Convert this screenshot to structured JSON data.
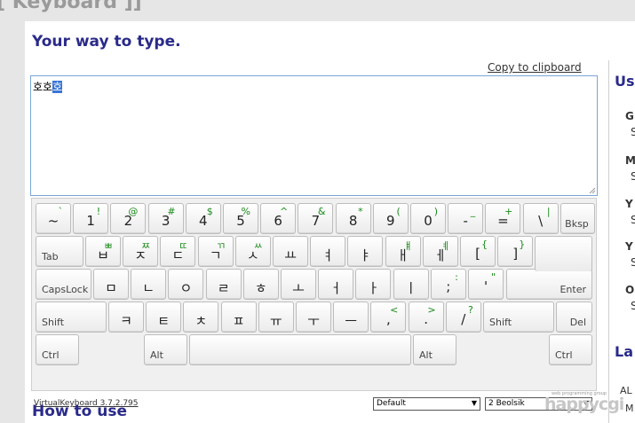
{
  "topbar": {
    "title": "[ Keyboard ]]"
  },
  "main": {
    "heading": "Your way to type.",
    "heading2": "How to use",
    "copy_label": "Copy to clipboard",
    "text_plain": "호호",
    "text_selected": "호"
  },
  "keyboard": {
    "version_link": "VirtualKeyboard 3.7.2.795",
    "skin_select": "Default",
    "layout_select": "2 Beolsik",
    "row1": [
      {
        "m": "~",
        "s": "`"
      },
      {
        "m": "1",
        "s": "!"
      },
      {
        "m": "2",
        "s": "@"
      },
      {
        "m": "3",
        "s": "#"
      },
      {
        "m": "4",
        "s": "$"
      },
      {
        "m": "5",
        "s": "%"
      },
      {
        "m": "6",
        "s": "^"
      },
      {
        "m": "7",
        "s": "&"
      },
      {
        "m": "8",
        "s": "*"
      },
      {
        "m": "9",
        "s": "("
      },
      {
        "m": "0",
        "s": ")"
      },
      {
        "m": "-",
        "s": "_"
      },
      {
        "m": "=",
        "s": "+"
      },
      {
        "m": "\\",
        "s": "|"
      }
    ],
    "row2": [
      {
        "m": "ㅂ",
        "s": "ㅃ"
      },
      {
        "m": "ㅈ",
        "s": "ㅉ"
      },
      {
        "m": "ㄷ",
        "s": "ㄸ"
      },
      {
        "m": "ㄱ",
        "s": "ㄲ"
      },
      {
        "m": "ㅅ",
        "s": "ㅆ"
      },
      {
        "m": "ㅛ",
        "s": ""
      },
      {
        "m": "ㅕ",
        "s": ""
      },
      {
        "m": "ㅑ",
        "s": ""
      },
      {
        "m": "ㅐ",
        "s": "ㅒ"
      },
      {
        "m": "ㅔ",
        "s": "ㅖ"
      },
      {
        "m": "[",
        "s": "{"
      },
      {
        "m": "]",
        "s": "}"
      }
    ],
    "row3": [
      {
        "m": "ㅁ",
        "s": ""
      },
      {
        "m": "ㄴ",
        "s": ""
      },
      {
        "m": "ㅇ",
        "s": ""
      },
      {
        "m": "ㄹ",
        "s": ""
      },
      {
        "m": "ㅎ",
        "s": ""
      },
      {
        "m": "ㅗ",
        "s": ""
      },
      {
        "m": "ㅓ",
        "s": ""
      },
      {
        "m": "ㅏ",
        "s": ""
      },
      {
        "m": "ㅣ",
        "s": ""
      },
      {
        "m": ";",
        "s": ":"
      },
      {
        "m": "'",
        "s": "\""
      }
    ],
    "row4": [
      {
        "m": "ㅋ",
        "s": ""
      },
      {
        "m": "ㅌ",
        "s": ""
      },
      {
        "m": "ㅊ",
        "s": ""
      },
      {
        "m": "ㅍ",
        "s": ""
      },
      {
        "m": "ㅠ",
        "s": ""
      },
      {
        "m": "ㅜ",
        "s": ""
      },
      {
        "m": "ㅡ",
        "s": ""
      },
      {
        "m": ",",
        "s": "<"
      },
      {
        "m": ".",
        "s": ">"
      },
      {
        "m": "/",
        "s": "?"
      }
    ],
    "fn": {
      "bksp": "Bksp",
      "tab": "Tab",
      "caps": "CapsLock",
      "enter": "Enter",
      "shift_l": "Shift",
      "shift_r": "Shift",
      "del": "Del",
      "ctrl_l": "Ctrl",
      "alt_l": "Alt",
      "alt_r": "Alt",
      "ctrl_r": "Ctrl"
    }
  },
  "right": {
    "h1": "Us",
    "items": [
      {
        "b": "G",
        "n": "S"
      },
      {
        "b": "M",
        "n": "S"
      },
      {
        "b": "Y",
        "n": "S"
      },
      {
        "b": "Y",
        "n": "S"
      },
      {
        "b": "O",
        "n": "S"
      }
    ],
    "h2": "La",
    "bottom1": "AL",
    "bottom2": "M"
  },
  "logo": {
    "small": "web programming group",
    "big": "happycgi"
  }
}
